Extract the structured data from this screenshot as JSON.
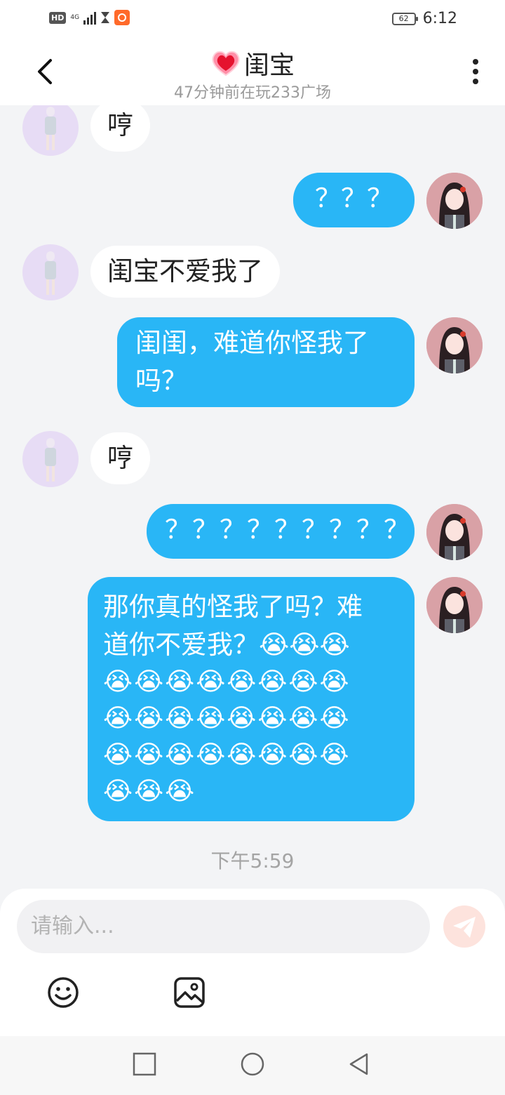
{
  "status_bar": {
    "hd": "HD",
    "network": "4G",
    "battery": "62",
    "time": "6:12"
  },
  "header": {
    "title": "闺宝",
    "subtitle": "47分钟前在玩233广场"
  },
  "messages": [
    {
      "side": "in",
      "text": "哼"
    },
    {
      "side": "out",
      "text": "？？？"
    },
    {
      "side": "in",
      "text": "闺宝不爱我了"
    },
    {
      "side": "out",
      "lines": [
        "闺闺，难道你怪我了",
        "吗？"
      ]
    },
    {
      "side": "in",
      "text": "哼"
    },
    {
      "side": "out",
      "text": "？？？？？？？？？"
    },
    {
      "side": "out",
      "lines": [
        "那你真的怪我了吗？难",
        "道你不爱我？😭😭😭",
        "😭😭😭😭😭😭😭😭",
        "😭😭😭😭😭😭😭😭",
        "😭😭😭😭😭😭😭😭",
        "😭😭😭"
      ]
    }
  ],
  "timestamp": "下午5:59",
  "input": {
    "placeholder": "请输入..."
  },
  "icons": {
    "back": "back-arrow-icon",
    "more": "more-vertical-icon",
    "send": "send-plane-icon",
    "emoji": "smiley-icon",
    "image": "image-icon"
  },
  "colors": {
    "outgoing_bubble": "#29b6f6",
    "incoming_bubble": "#ffffff",
    "background": "#f3f4f6"
  }
}
